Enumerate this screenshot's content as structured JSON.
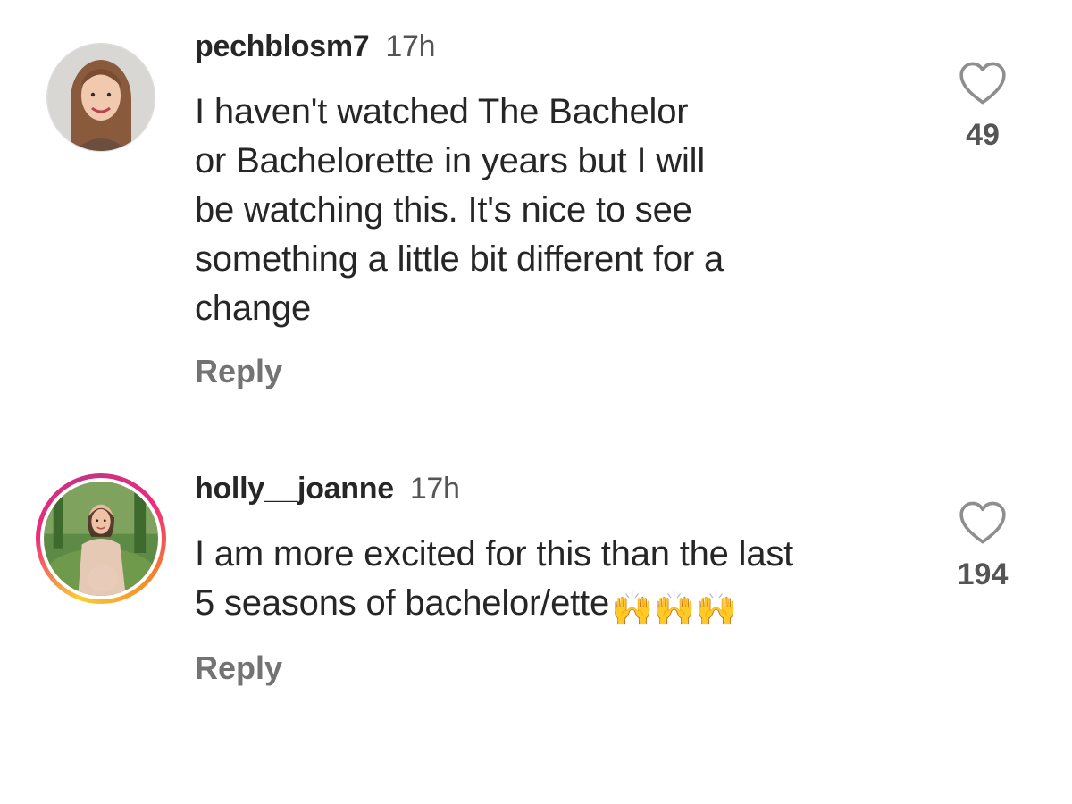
{
  "comments": [
    {
      "username": "pechblosm7",
      "time": "17h",
      "text": "I haven't watched The Bachelor\nor Bachelorette in years but I will\nbe watching this. It's nice to see\nsomething a little bit different for a\nchange",
      "emoji": "",
      "reply_label": "Reply",
      "likes": "49",
      "story_ring": false,
      "like_icon": "heart-outline-icon"
    },
    {
      "username": "holly__joanne",
      "time": "17h",
      "text": "I am more excited for this than the last\n5 seasons of bachelor/ette",
      "emoji": "🙌🙌🙌",
      "reply_label": "Reply",
      "likes": "194",
      "story_ring": true,
      "like_icon": "heart-outline-icon"
    }
  ],
  "colors": {
    "text": "#262626",
    "meta": "#737373",
    "story_ring_start": "#f9ce34",
    "story_ring_mid": "#ee2a7b",
    "story_ring_end": "#c13584"
  }
}
